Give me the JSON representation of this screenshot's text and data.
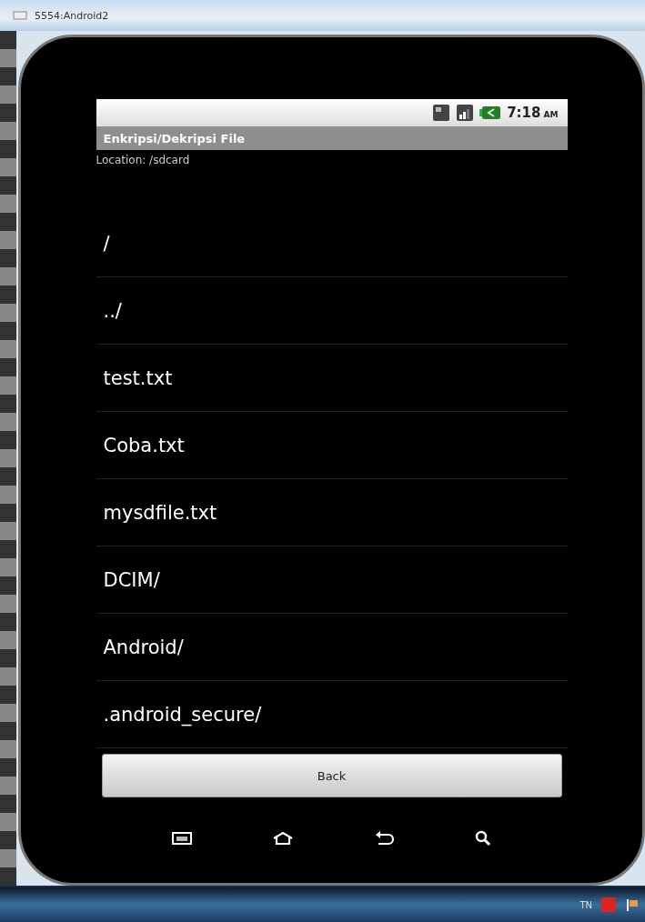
{
  "window": {
    "title": "5554:Android2"
  },
  "status_bar": {
    "time": "7:18",
    "meridiem": "AM"
  },
  "app": {
    "title": "Enkripsi/Dekripsi File",
    "location": "Location: /sdcard"
  },
  "files": [
    {
      "name": "/"
    },
    {
      "name": "../"
    },
    {
      "name": "test.txt"
    },
    {
      "name": "Coba.txt"
    },
    {
      "name": "mysdfile.txt"
    },
    {
      "name": "DCIM/"
    },
    {
      "name": "Android/"
    },
    {
      "name": ".android_secure/"
    }
  ],
  "back_button": "Back",
  "nav_keys": [
    {
      "kind": "menu"
    },
    {
      "kind": "home"
    },
    {
      "kind": "back"
    },
    {
      "kind": "search"
    }
  ],
  "taskbar": {
    "tray_text": "TN"
  }
}
